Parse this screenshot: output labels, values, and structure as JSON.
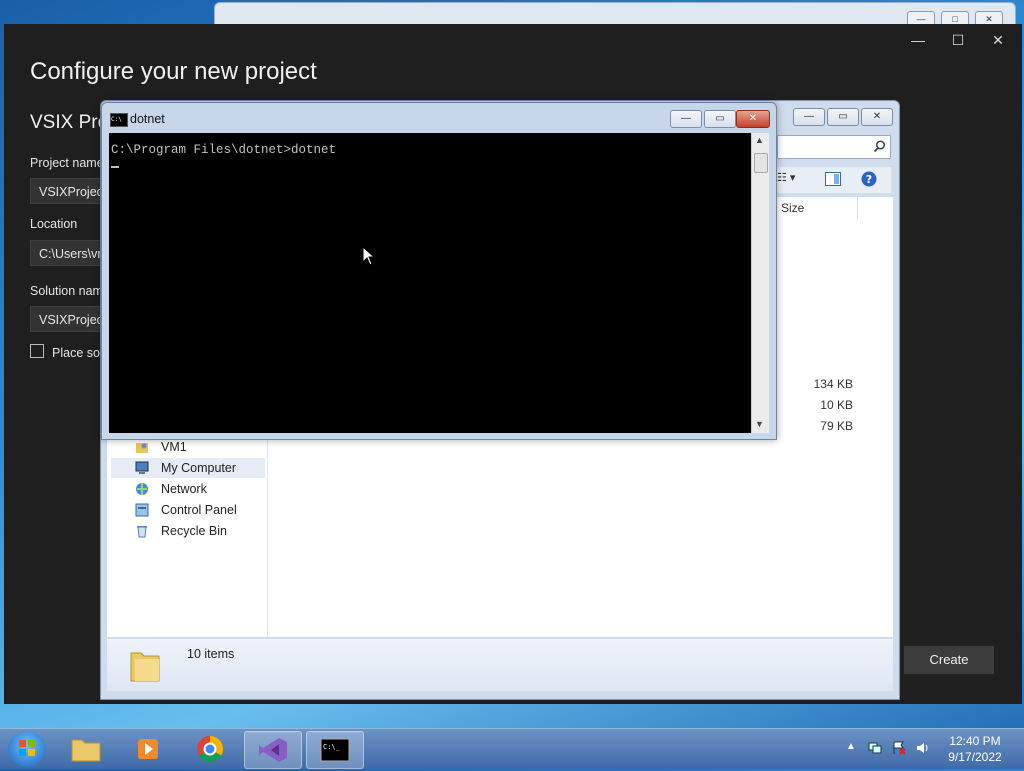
{
  "vs_dialog": {
    "heading": "Configure your new project",
    "project_type": "VSIX Pro",
    "project_name_label": "Project name",
    "project_name_value": "VSIXProject",
    "location_label": "Location",
    "location_value": "C:\\Users\\vr",
    "solution_name_label": "Solution nam",
    "solution_name_value": "VSIXProject",
    "place_checkbox_label": "Place solu",
    "create_label": "Create"
  },
  "explorer": {
    "column_size": "Size",
    "sizes": [
      "134 KB",
      "10 KB",
      "79 KB"
    ],
    "nav_items": [
      "VM1",
      "My Computer",
      "Network",
      "Control Panel",
      "Recycle Bin"
    ],
    "status": "10 items"
  },
  "cmd": {
    "title": "dotnet",
    "line": "C:\\Program Files\\dotnet>dotnet"
  },
  "taskbar": {
    "time": "12:40 PM",
    "date": "9/17/2022"
  }
}
